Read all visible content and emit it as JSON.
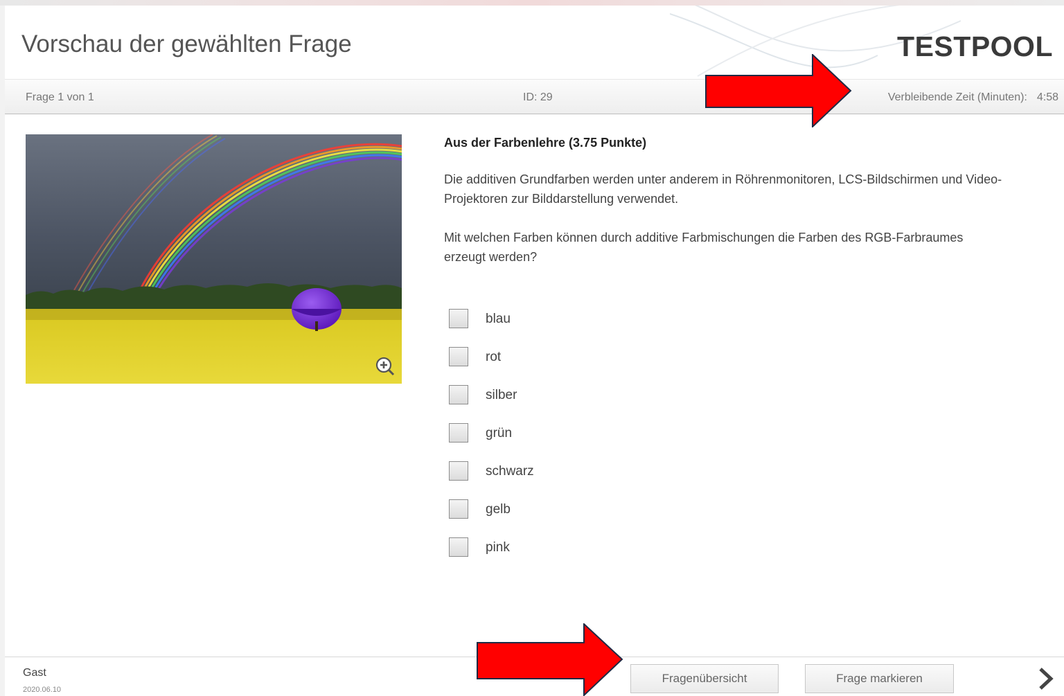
{
  "header": {
    "title": "Vorschau der gewählten Frage",
    "brand": "TESTPOOL"
  },
  "infobar": {
    "counter": "Frage 1 von 1",
    "id": "ID: 29",
    "timer_label": "Verbleibende Zeit (Minuten):",
    "timer_value": "4:58"
  },
  "question": {
    "title": "Aus der Farbenlehre (3.75 Punkte)",
    "text1": "Die additiven Grundfarben werden unter anderem in Röhrenmonitoren, LCS-Bildschirmen und Video-Projektoren zur Bilddarstellung verwendet.",
    "text2": "Mit welchen Farben können durch additive Farbmischungen die Farben des RGB-Farbraumes erzeugt werden?",
    "options": [
      "blau",
      "rot",
      "silber",
      "grün",
      "schwarz",
      "gelb",
      "pink"
    ]
  },
  "footer": {
    "user": "Gast",
    "date": "2020.06.10",
    "overview_button": "Fragenübersicht",
    "mark_button": "Frage markieren"
  },
  "colors": {
    "annotation_arrow": "#ff0000",
    "arrow_outline": "#1f2a44",
    "field": "#e0cf2a"
  },
  "icons": [
    "zoom-in-icon",
    "chevron-right-icon",
    "red-arrow-annotation"
  ]
}
